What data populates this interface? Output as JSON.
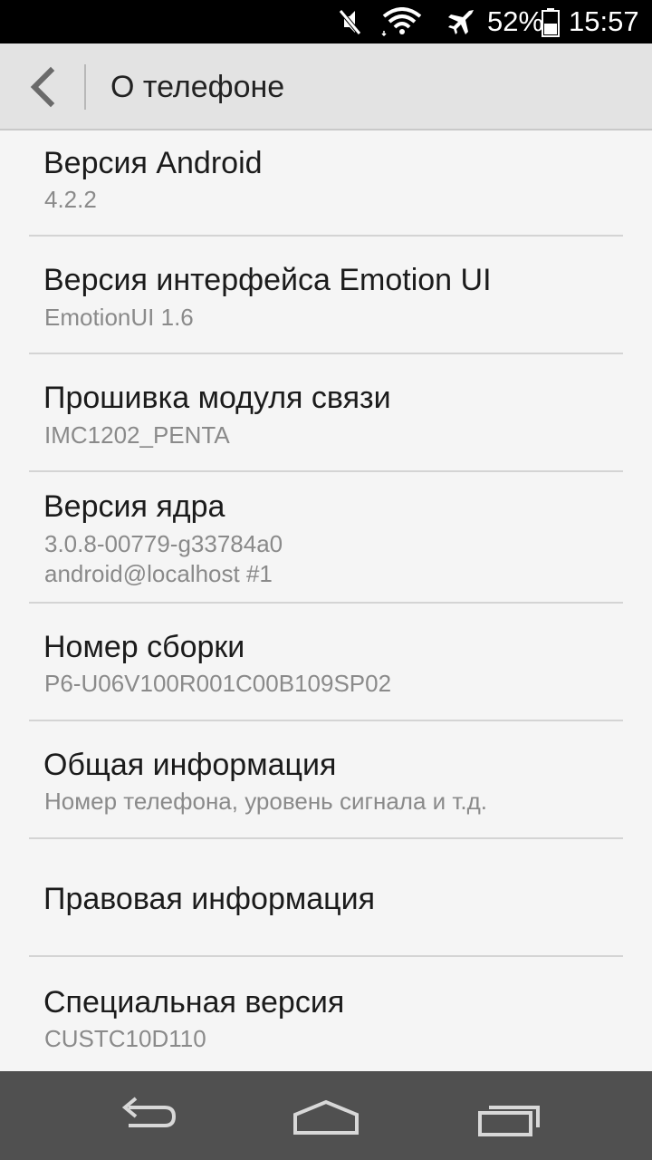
{
  "status_bar": {
    "battery_percent": "52%",
    "battery_level": 0.52,
    "time": "15:57",
    "icons": [
      "mute-icon",
      "wifi-icon",
      "airplane-icon",
      "battery-icon"
    ]
  },
  "action_bar": {
    "title": "О телефоне",
    "back_icon": "chevron-left-icon"
  },
  "items": [
    {
      "title": "Версия Android",
      "summary": "4.2.2"
    },
    {
      "title": "Версия интерфейса Emotion UI",
      "summary": "EmotionUI 1.6"
    },
    {
      "title": "Прошивка модуля связи",
      "summary": "IMC1202_PENTA"
    },
    {
      "title": "Версия ядра",
      "summary": "3.0.8-00779-g33784a0\nandroid@localhost #1"
    },
    {
      "title": "Номер сборки",
      "summary": "P6-U06V100R001C00B109SP02"
    },
    {
      "title": "Общая информация",
      "summary": "Номер телефона, уровень сигнала и т.д."
    },
    {
      "title": "Правовая информация",
      "summary": ""
    },
    {
      "title": "Специальная версия",
      "summary": "CUSTC10D110"
    }
  ],
  "nav_bar": {
    "icons": [
      "back-arrow-icon",
      "home-icon",
      "recent-apps-icon"
    ]
  },
  "colors": {
    "status_bar_bg": "#000000",
    "action_bar_bg": "#e3e3e3",
    "list_bg": "#f5f5f5",
    "nav_bar_bg": "#505050",
    "title_text": "#1b1b1b",
    "summary_text": "#8a8a8a"
  }
}
